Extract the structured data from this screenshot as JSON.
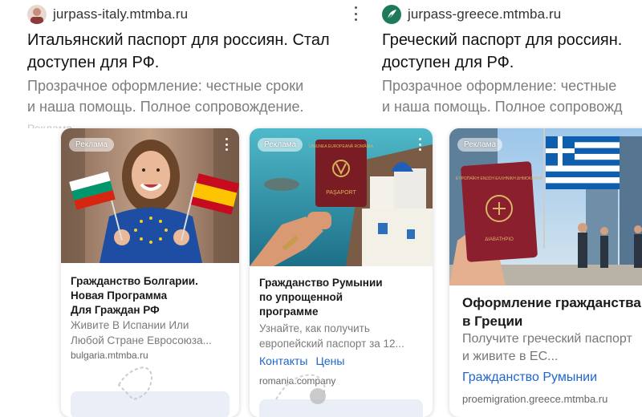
{
  "top_ads": [
    {
      "domain": "jurpass-italy.mtmba.ru",
      "headline_line1": "Итальянский паспорт для россиян. Стал",
      "headline_line2": "доступен для РФ.",
      "desc_line1": "Прозрачное оформление: честные сроки",
      "desc_line2": "и наша помощь. Полное сопровождение.",
      "cut_text": "Реклама"
    },
    {
      "domain": "jurpass-greece.mtmba.ru",
      "headline_line1": "Греческий паспорт для россиян.",
      "headline_line2": "доступен для РФ.",
      "desc_line1": "Прозрачное оформление: честные",
      "desc_line2": "и наша помощь. Полное сопровожд"
    }
  ],
  "cards": [
    {
      "badge": "Реклама",
      "title_line1": "Гражданство Болгарии.",
      "title_line2": "Новая Программа",
      "title_line3": "Для Граждан РФ",
      "text_line1": "Живите В Испании Или",
      "text_line2": "Любой Стране Евросоюза...",
      "domain": "bulgaria.mtmba.ru"
    },
    {
      "badge": "Реклама",
      "passport_country": "UNIUNEA EUROPEANĂ ROMÂNIA",
      "passport_word": "PAŞAPORT",
      "title_line1": "Гражданство Румынии",
      "title_line2": "по упрощенной",
      "title_line3": "программе",
      "text_line1": "Узнайте, как получить",
      "text_line2": "европейский паспорт за 12...",
      "link1": "Контакты",
      "link2": "Цены",
      "domain": "romania.company"
    },
    {
      "badge": "Реклама",
      "passport_country": "ΕΥΡΩΠΑΪΚΗ ΕΝΩΣΗ ΕΛΛΗΝΙΚΗ ΔΗΜΟΚΡΑΤΙΑ",
      "passport_word": "ΔΙΑΒΑΤΗΡΙΟ",
      "title_line1": "Оформление гражданства",
      "title_line2": "в Греции",
      "text_line1": "Получите греческий паспорт",
      "text_line2": "и живите в ЕС...",
      "link": "Гражданство Румынии",
      "domain": "proemigration.greece.mtmba.ru"
    }
  ],
  "icons": {
    "favicon1": "avatar-favicon",
    "favicon2": "leaf-logo-favicon",
    "kebab": "more-vertical-icon",
    "finger": "hand-pointer-icon"
  },
  "colors": {
    "link": "#1f66cc",
    "muted_text": "#7b7b7b",
    "favicon_green": "#1e7a5a"
  }
}
